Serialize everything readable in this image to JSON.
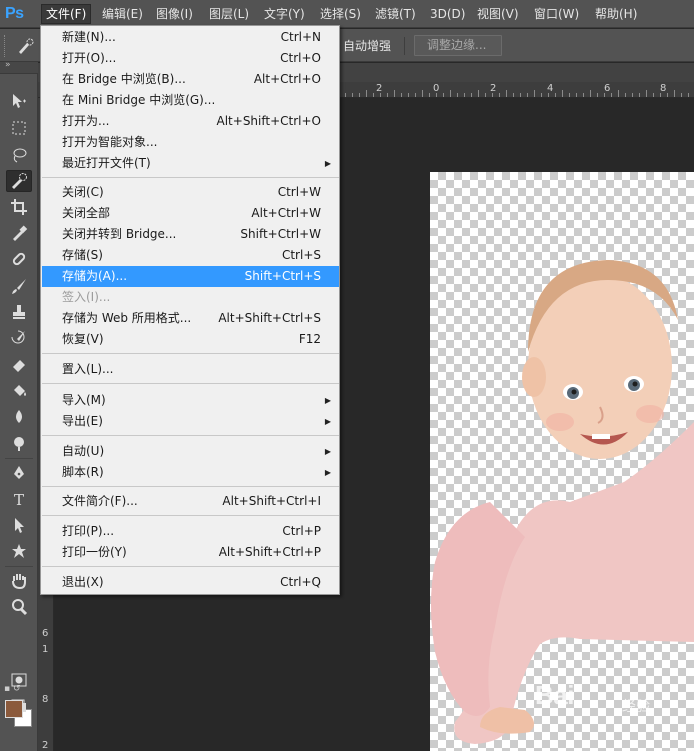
{
  "app": {
    "logo": "Ps"
  },
  "menubar": {
    "items": [
      "文件(F)",
      "编辑(E)",
      "图像(I)",
      "图层(L)",
      "文字(Y)",
      "选择(S)",
      "滤镜(T)",
      "3D(D)",
      "视图(V)",
      "窗口(W)",
      "帮助(H)"
    ],
    "active": "文件(F)"
  },
  "options": {
    "auto_enhance": "自动增强",
    "refine_edge": "调整边缘..."
  },
  "ruler": {
    "top_numbers": [
      "2",
      "0",
      "2",
      "4",
      "6",
      "8"
    ],
    "left_numbers": [
      "6",
      "1",
      "8",
      "2"
    ]
  },
  "file_menu": {
    "items": [
      {
        "label": "新建(N)...",
        "shortcut": "Ctrl+N"
      },
      {
        "label": "打开(O)...",
        "shortcut": "Ctrl+O"
      },
      {
        "label": "在 Bridge 中浏览(B)...",
        "shortcut": "Alt+Ctrl+O"
      },
      {
        "label": "在 Mini Bridge 中浏览(G)...",
        "shortcut": ""
      },
      {
        "label": "打开为...",
        "shortcut": "Alt+Shift+Ctrl+O"
      },
      {
        "label": "打开为智能对象...",
        "shortcut": ""
      },
      {
        "label": "最近打开文件(T)",
        "shortcut": ""
      },
      {
        "label": "关闭(C)",
        "shortcut": "Ctrl+W"
      },
      {
        "label": "关闭全部",
        "shortcut": "Alt+Ctrl+W"
      },
      {
        "label": "关闭并转到 Bridge...",
        "shortcut": "Shift+Ctrl+W"
      },
      {
        "label": "存储(S)",
        "shortcut": "Ctrl+S"
      },
      {
        "label": "存储为(A)...",
        "shortcut": "Shift+Ctrl+S"
      },
      {
        "label": "签入(I)...",
        "shortcut": ""
      },
      {
        "label": "存储为 Web 所用格式...",
        "shortcut": "Alt+Shift+Ctrl+S"
      },
      {
        "label": "恢复(V)",
        "shortcut": "F12"
      },
      {
        "label": "置入(L)...",
        "shortcut": ""
      },
      {
        "label": "导入(M)",
        "shortcut": ""
      },
      {
        "label": "导出(E)",
        "shortcut": ""
      },
      {
        "label": "自动(U)",
        "shortcut": ""
      },
      {
        "label": "脚本(R)",
        "shortcut": ""
      },
      {
        "label": "文件简介(F)...",
        "shortcut": "Alt+Shift+Ctrl+I"
      },
      {
        "label": "打印(P)...",
        "shortcut": "Ctrl+P"
      },
      {
        "label": "打印一份(Y)",
        "shortcut": "Alt+Shift+Ctrl+P"
      },
      {
        "label": "退出(X)",
        "shortcut": "Ctrl+Q"
      }
    ],
    "highlighted": "存储为(A)...",
    "disabled": [
      "签入(I)..."
    ]
  },
  "colors": {
    "foreground": "#8b5a3c",
    "background": "#ffffff",
    "highlight": "#3399ff",
    "logo": "#3aa3ff"
  },
  "watermark": {
    "brand": "Bai",
    "suffix": "经验"
  }
}
